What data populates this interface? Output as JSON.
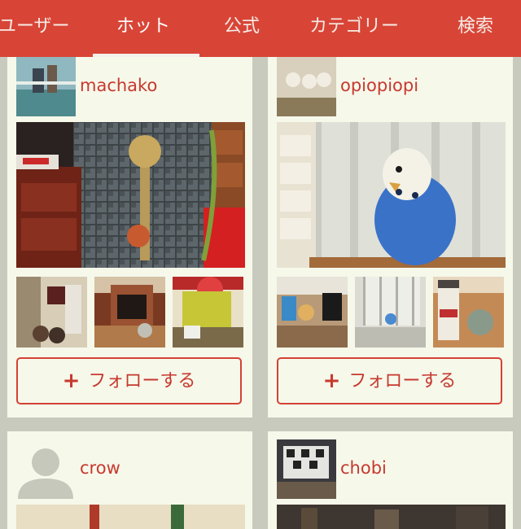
{
  "tabs": [
    {
      "label": "ユーザー"
    },
    {
      "label": "ホット"
    },
    {
      "label": "公式"
    },
    {
      "label": "カテゴリー"
    },
    {
      "label": "検索"
    }
  ],
  "active_tab": "ホット",
  "follow_label": "フォローする",
  "users": [
    {
      "name": "machako"
    },
    {
      "name": "opiopiopi"
    },
    {
      "name": "crow"
    },
    {
      "name": "chobi"
    }
  ],
  "colors": {
    "accent": "#d84537",
    "card_background": "#f6f8ea",
    "page_background": "#c9cabe"
  },
  "icons": {
    "follow": "plus-icon",
    "default_avatar": "user-silhouette-icon"
  }
}
